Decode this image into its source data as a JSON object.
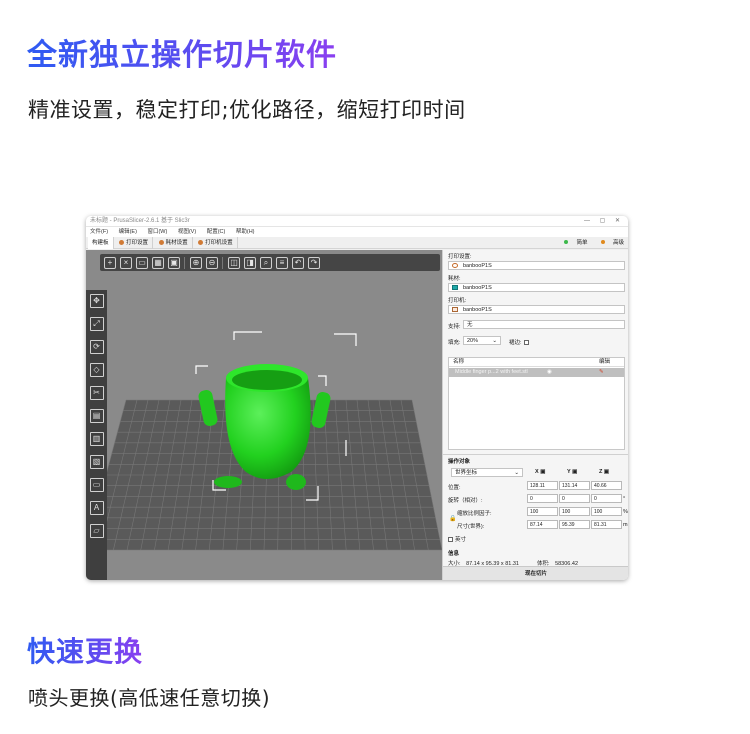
{
  "sections": [
    {
      "headline": "全新独立操作切片软件",
      "description": "精准设置，稳定打印;优化路径，缩短打印时间"
    },
    {
      "headline": "快速更换",
      "description": "喷头更换(高低速任意切换)"
    }
  ],
  "window": {
    "title": "未标题 - PrusaSlicer-2.6.1 基于 Slic3r",
    "menu": [
      "文件(F)",
      "编辑(E)",
      "窗口(W)",
      "视图(V)",
      "配置(C)",
      "帮助(H)"
    ],
    "tabs": [
      "构建板",
      "打印设置",
      "耗材设置",
      "打印机设置"
    ],
    "modes": [
      "简单",
      "高级"
    ],
    "toolbar_icons": [
      "add-icon",
      "delete-icon",
      "delete-all-icon",
      "arrange-icon",
      "copy-icon",
      "paste-icon",
      "add-instance-icon",
      "remove-instance-icon",
      "split-objects-icon",
      "split-parts-icon",
      "search-icon",
      "layers-icon",
      "undo-icon",
      "redo-icon"
    ],
    "left_tool_icons": [
      "move-icon",
      "scale-icon",
      "rotate-icon",
      "place-on-face-icon",
      "cut-icon",
      "paint-supports-icon",
      "seam-icon",
      "mmu-paint-icon",
      "measure-icon",
      "emboss-icon",
      "layer-view-icon"
    ]
  },
  "panel": {
    "print_settings_label": "打印设置:",
    "print_settings_value": "banbooP1S",
    "filament_label": "耗材:",
    "filament_value": "banbooP1S",
    "filament_color": "#1fa8a8",
    "printer_label": "打印机:",
    "printer_value": "banbooP1S",
    "support_label": "支持:",
    "support_value": "无",
    "infill_label": "填充:",
    "infill_value": "20%",
    "brim_label": "裙边:",
    "list_header_name": "名称",
    "list_header_edit": "编辑",
    "object_name": "Middle finger p...2 with feet.stl",
    "manipulation_title": "操作对象",
    "coord_system": "世界坐标",
    "axes": [
      "X",
      "Y",
      "Z"
    ],
    "position_label": "位置:",
    "position": [
      "128.11",
      "131.14",
      "40.66"
    ],
    "rotation_label": "旋转（相对）:",
    "rotation": [
      "0",
      "0",
      "0"
    ],
    "rotation_unit": "°",
    "scale_label": "缩放比例因子:",
    "scale": [
      "100",
      "100",
      "100"
    ],
    "scale_unit": "%",
    "size_label": "尺寸(世界):",
    "size": [
      "87.14",
      "95.39",
      "81.31"
    ],
    "size_unit": "mm",
    "inch_label": "英寸",
    "info_title": "信息",
    "info_size_label": "大小:",
    "info_size_value": "87.14 x 95.39 x 81.31",
    "info_volume_label": "体积:",
    "info_volume_value": "58306.42",
    "slice_button": "现在切片"
  },
  "colors": {
    "model": "#22d11f",
    "bed": "#5a5a5a",
    "bed_grid": "#777777",
    "viewport_bg": "#8a8a8a",
    "headline_start": "#2f5bf2",
    "headline_end": "#8a3ff0"
  }
}
